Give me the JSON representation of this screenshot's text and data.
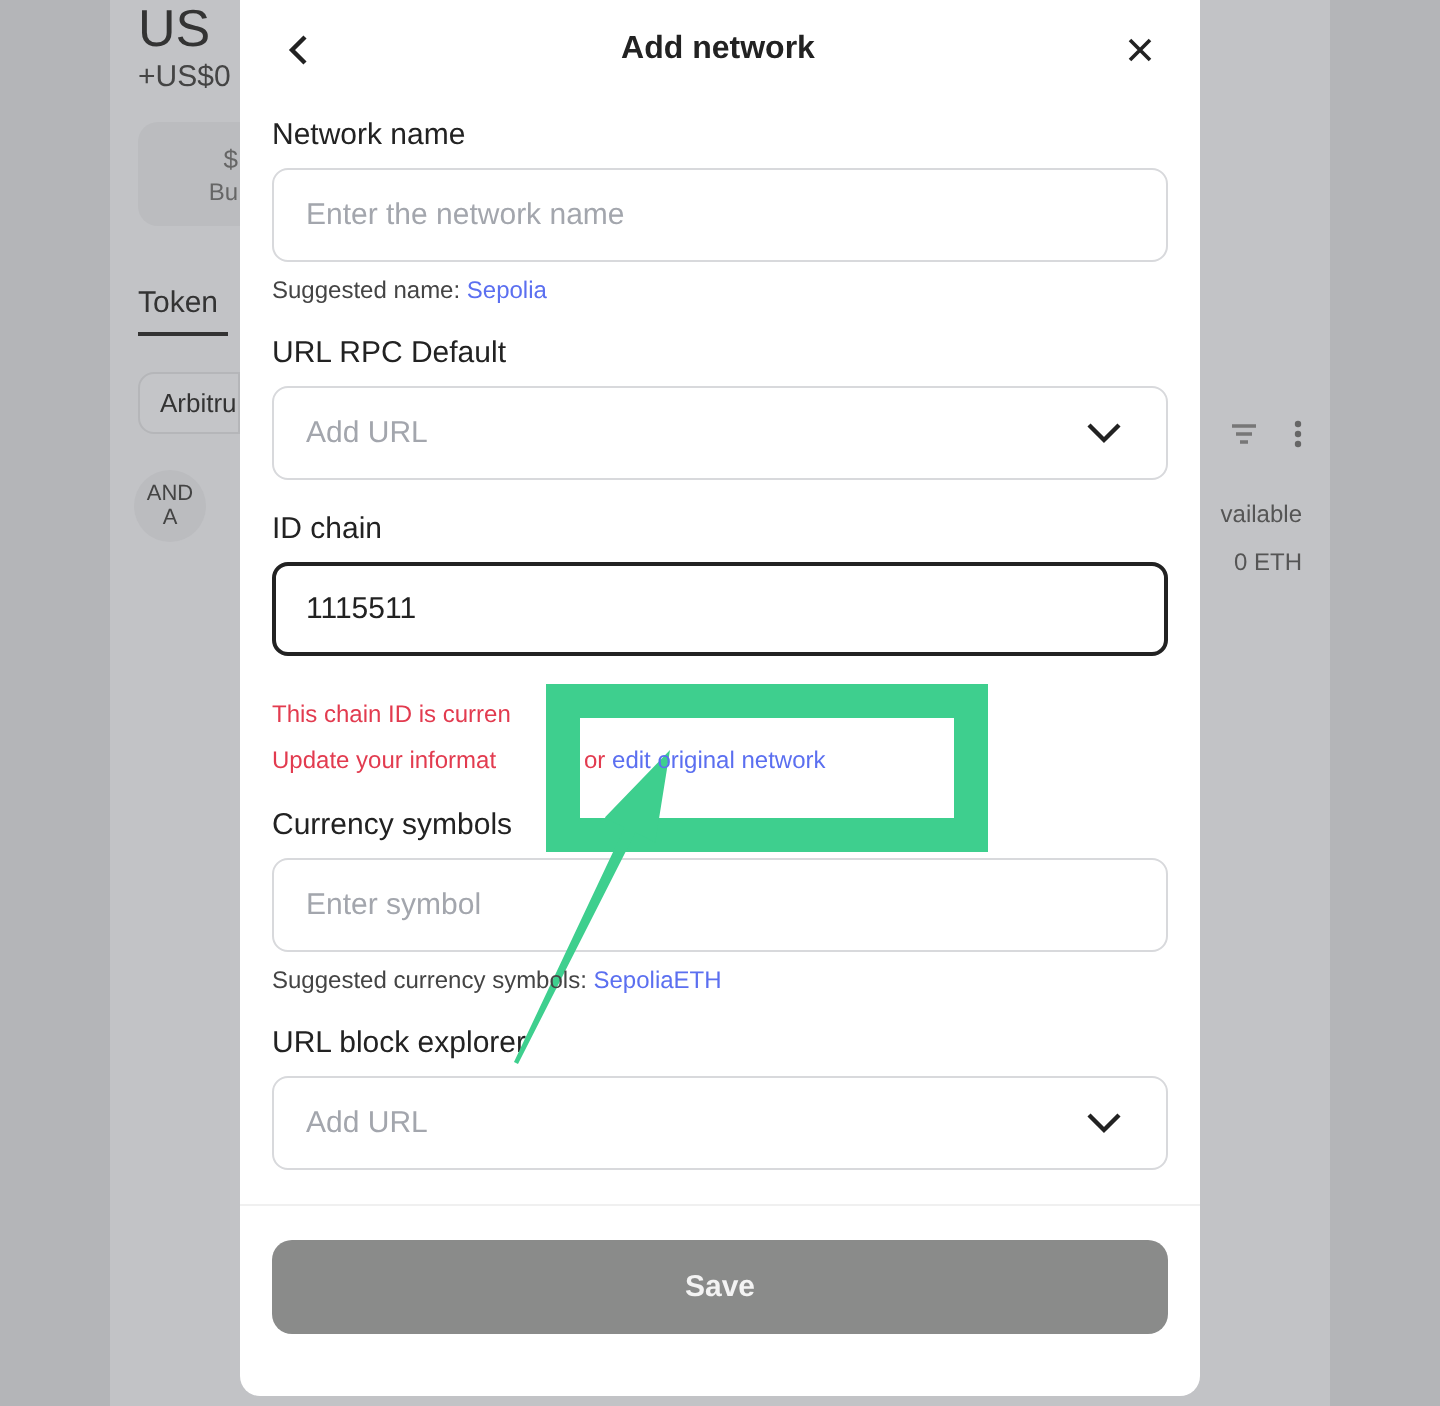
{
  "background_app": {
    "balance": "US",
    "change": "+US$0",
    "action_card": {
      "icon_text": "$",
      "label": "Bu"
    },
    "tab": "Token",
    "network_chip": "Arbitru",
    "token_avatar": [
      "AND",
      "A"
    ],
    "column_header": "vailable",
    "balance_value": "0 ETH"
  },
  "dialog": {
    "title": "Add network",
    "fields": [
      {
        "kind": "text",
        "label": "Network name",
        "placeholder": "Enter the network name",
        "focused": false,
        "hint": {
          "text": "Suggested name:",
          "link": "Sepolia"
        }
      },
      {
        "kind": "select",
        "label": "URL RPC Default",
        "placeholder": "Add URL"
      },
      {
        "kind": "text",
        "label": "ID chain",
        "value": "1115511",
        "focused": true,
        "error": {
          "line_1": "This chain ID is curren",
          "line_2": "Update your informat",
          "connector": "or",
          "link": "edit original network"
        }
      },
      {
        "kind": "text",
        "label": "Currency symbols",
        "placeholder": "Enter symbol",
        "focused": false,
        "hint": {
          "text": "Suggested currency symbols:",
          "link": "SepoliaETH"
        }
      },
      {
        "kind": "select",
        "label": "URL block explorer",
        "placeholder": "Add URL"
      }
    ],
    "save_button": {
      "label": "Save",
      "disabled": true
    }
  }
}
